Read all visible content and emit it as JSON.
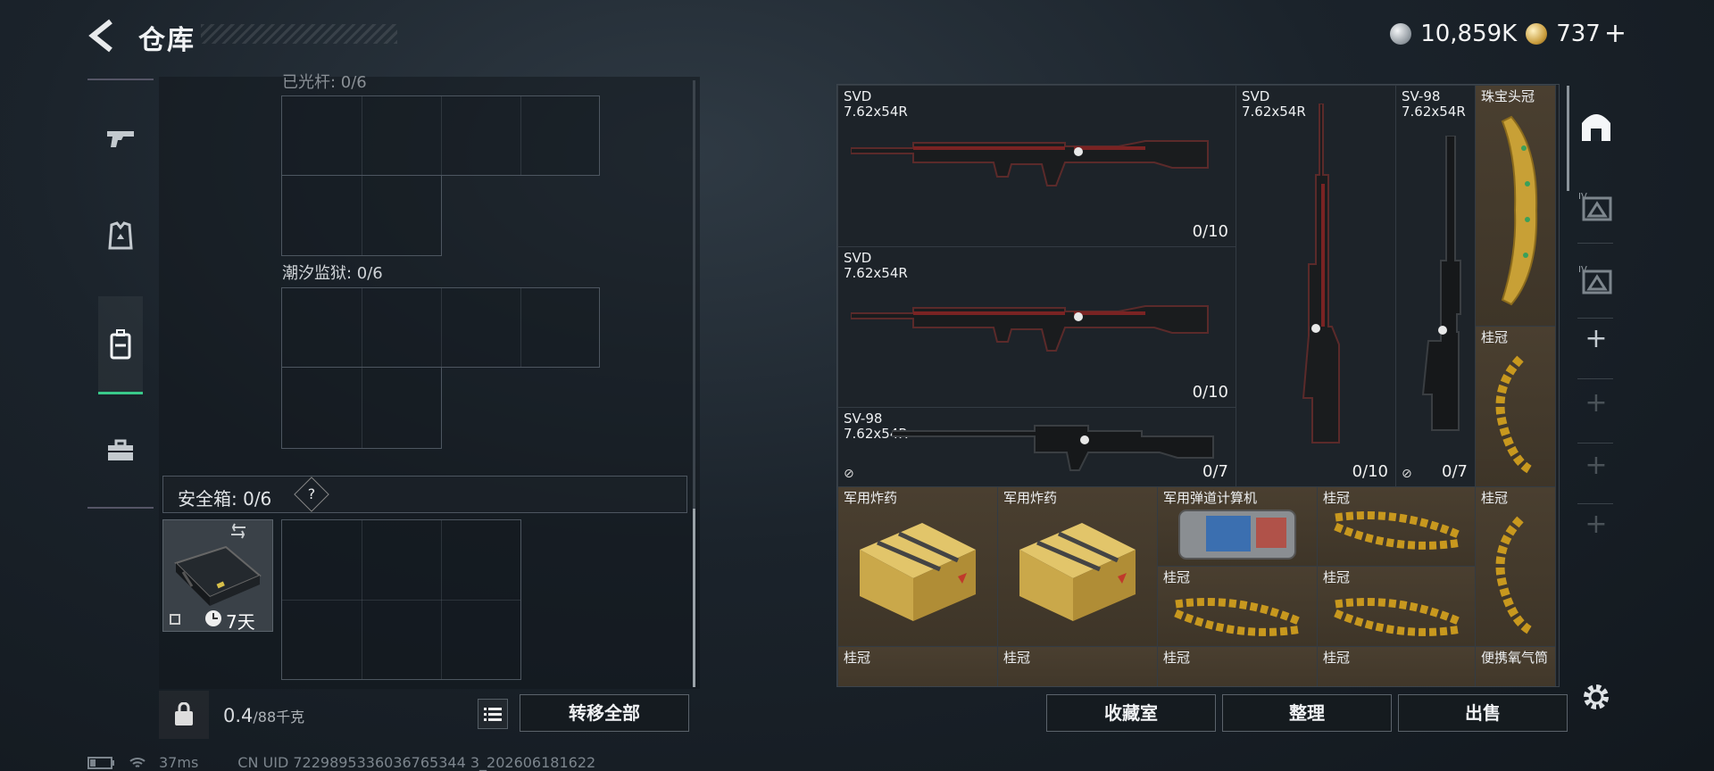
{
  "header": {
    "title": "仓库",
    "currency_silver": "10,859K",
    "currency_gold": "737",
    "plus": "+"
  },
  "left_panel": {
    "slot_a_label": "已光杆: 0/6",
    "slot_b_label": "潮汐监狱: 0/6",
    "safe_label": "安全箱: 0/6",
    "safe_help": "?",
    "case_timer": "7天"
  },
  "footer": {
    "weight_value": "0.4",
    "weight_cap": "/88千克",
    "transfer_all": "转移全部",
    "collection": "收藏室",
    "sort": "整理",
    "sell": "出售"
  },
  "status": {
    "ping": "37ms",
    "uid": "CN UID 7229895336036765344 3_202606181622"
  },
  "inventory": {
    "items": [
      {
        "name": "SVD\n7.62x54R",
        "count": "0/10"
      },
      {
        "name": "SVD\n7.62x54R",
        "count": "0/10"
      },
      {
        "name": "SV-98\n7.62x54R",
        "count": "0/7"
      },
      {
        "name": "SVD\n7.62x54R",
        "count": "0/10"
      },
      {
        "name": "SV-98\n7.62x54R",
        "count": "0/7"
      },
      {
        "name": "珠宝头冠",
        "count": ""
      },
      {
        "name": "桂冠",
        "count": ""
      },
      {
        "name": "军用炸药",
        "count": ""
      },
      {
        "name": "军用炸药",
        "count": ""
      },
      {
        "name": "军用弹道计算机",
        "count": ""
      },
      {
        "name": "桂冠",
        "count": ""
      },
      {
        "name": "桂冠",
        "count": ""
      },
      {
        "name": "桂冠",
        "count": ""
      },
      {
        "name": "桂冠",
        "count": ""
      },
      {
        "name": "桂冠",
        "count": ""
      },
      {
        "name": "桂冠",
        "count": ""
      },
      {
        "name": "桂冠",
        "count": ""
      },
      {
        "name": "桂冠",
        "count": ""
      },
      {
        "name": "便携氧气筒",
        "count": ""
      }
    ]
  },
  "right_tabs": [
    "storage-icon",
    "tier-4-icon",
    "tier-4-icon",
    "plus-icon",
    "plus-icon",
    "plus-icon",
    "plus-icon"
  ],
  "colors": {
    "accent": "#39c98a",
    "gold_cell": "#4a3f30"
  }
}
